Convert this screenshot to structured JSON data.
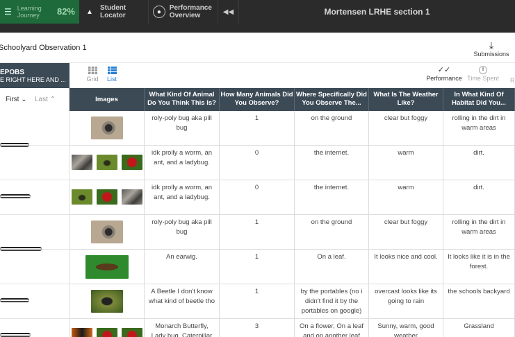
{
  "nav": {
    "learning_journey_label": "Learning Journey",
    "learning_journey_pct": "82%",
    "student_locator": "Student Locator",
    "performance_overview": "Performance Overview",
    "section_title": "Mortensen LRHE section 1"
  },
  "assignment": {
    "title": "Schoolyard Observation 1",
    "submissions_label": "Submissions"
  },
  "left_panel": {
    "code": "EPOBS",
    "subtitle": "E RIGHT HERE AND ...",
    "sort_first": "First",
    "sort_last": "Last"
  },
  "view": {
    "grid_label": "Grid",
    "list_label": "List",
    "performance_label": "Performance",
    "time_spent_label": "Time Spent",
    "clipped_label": "R"
  },
  "table": {
    "columns": [
      "Images",
      "What Kind Of Animal Do You Think This Is?",
      "How Many Animals Did You Observe?",
      "Where Specifically Did You Observe The...",
      "What Is The Weather Like?",
      "In What Kind Of Habitat Did You..."
    ],
    "rows": [
      {
        "images": [
          "pillbug"
        ],
        "animal": "roly-poly bug aka pill bug",
        "count": "1",
        "where": "on the ground",
        "weather": "clear but foggy",
        "habitat": "rolling in the dirt in warm areas"
      },
      {
        "images": [
          "worm",
          "ant",
          "ladybug"
        ],
        "animal": "idk prolly a worm, an ant, and a ladybug.",
        "count": "0",
        "where": "the internet.",
        "weather": "warm",
        "habitat": "dirt."
      },
      {
        "images": [
          "ant",
          "ladybug",
          "worm"
        ],
        "animal": "idk prolly a worm, an ant, and a ladybug.",
        "count": "0",
        "where": "the internet.",
        "weather": "warm",
        "habitat": "dirt."
      },
      {
        "images": [
          "pillbug"
        ],
        "animal": "roly-poly bug aka pill bug",
        "count": "1",
        "where": "on the ground",
        "weather": "clear but foggy",
        "habitat": "rolling in the dirt in warm areas"
      },
      {
        "images": [
          "earwig"
        ],
        "animal": "An earwig.",
        "count": "1",
        "where": "On a leaf.",
        "weather": "It looks nice and cool.",
        "habitat": "It looks like it is in the forest."
      },
      {
        "images": [
          "beetle"
        ],
        "animal": "A Beetle I don't know what kind of beetle tho",
        "count": "1",
        "where": "by the portables (no i didn't find it by the portables on google)",
        "weather": "overcast looks like its going to rain",
        "habitat": "the schools backyard"
      },
      {
        "images": [
          "monarch",
          "ladybug",
          "ladybug"
        ],
        "animal": "Monarch Butterfly, Lady bug, Caterpillar",
        "count": "3",
        "where": "On a flower, On a leaf and on another leaf",
        "weather": "Sunny, warm, good weather",
        "habitat": "Grassland"
      }
    ]
  }
}
